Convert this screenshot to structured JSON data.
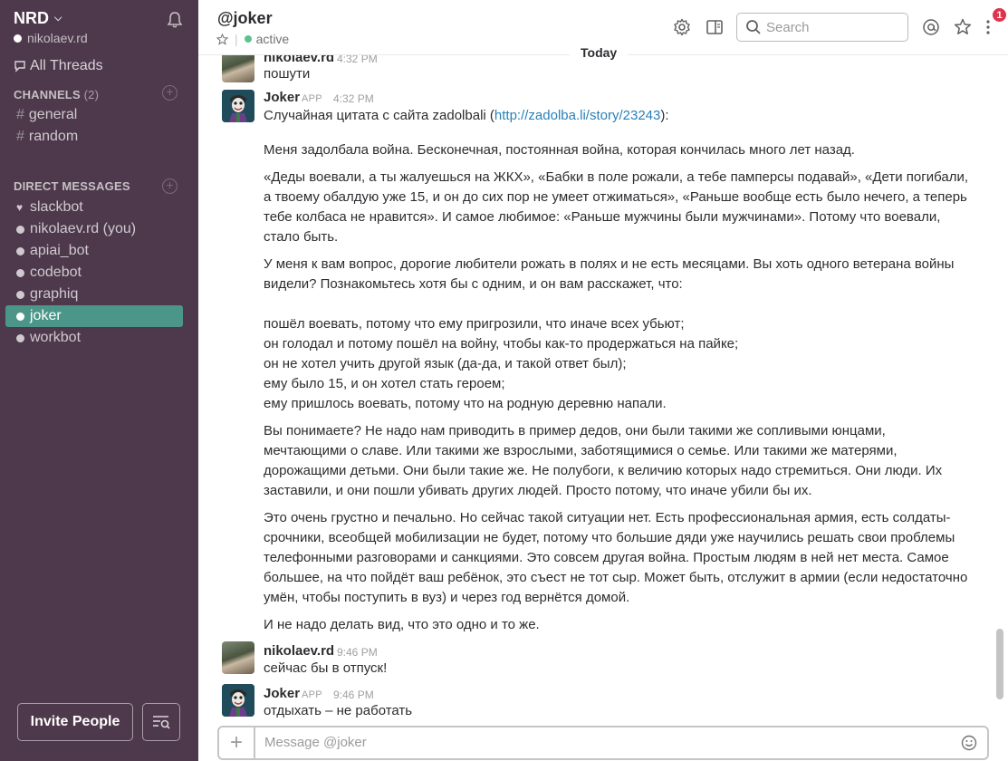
{
  "sidebar": {
    "team_name": "NRD",
    "user": "nikolaev.rd",
    "all_threads": "All Threads",
    "channels_header": "CHANNELS",
    "channels_count": "(2)",
    "channels": [
      {
        "label": "general"
      },
      {
        "label": "random"
      }
    ],
    "dm_header": "DIRECT MESSAGES",
    "dms": [
      {
        "label": "slackbot"
      },
      {
        "label": "nikolaev.rd (you)"
      },
      {
        "label": "apiai_bot"
      },
      {
        "label": "codebot"
      },
      {
        "label": "graphiq"
      },
      {
        "label": "joker"
      },
      {
        "label": "workbot"
      }
    ],
    "invite": "Invite People"
  },
  "header": {
    "title": "@joker",
    "status": "active",
    "search_placeholder": "Search",
    "notification_count": "1"
  },
  "divider": "Today",
  "messages": [
    {
      "sender": "nikolaev.rd",
      "time": "4:32 PM",
      "text": "пошути"
    },
    {
      "sender": "Joker",
      "app": "APP",
      "time": "4:32 PM",
      "intro": "Случайная цитата с сайта zadolbali (",
      "link": "http://zadolba.li/story/23243",
      "intro_end": "):",
      "paragraphs": [
        "Меня задолбала война. Бесконечная, постоянная война, которая кончилась много лет назад.",
        "«Деды воевали, а ты жалуешься на ЖКХ», «Бабки в поле рожали, а тебе памперсы подавай», «Дети погибали, а твоему обалдую уже 15, и он до сих пор не умеет отжиматься», «Раньше вообще есть было нечего, а теперь тебе колбаса не нравится». И самое любимое: «Раньше мужчины были мужчинами». Потому что воевали, стало быть.",
        "У меня к вам вопрос, дорогие любители рожать в полях и не есть месяцами. Вы хоть одного ветерана войны видели? Познакомьтесь хотя бы с одним, и он вам расскажет, что:"
      ],
      "list": [
        "пошёл воевать, потому что ему пригрозили, что иначе всех убьют;",
        "он голодал и потому пошёл на войну, чтобы как-то продержаться на пайке;",
        "он не хотел учить другой язык (да-да, и такой ответ был);",
        "ему было 15, и он хотел стать героем;",
        "ему пришлось воевать, потому что на родную деревню напали."
      ],
      "paragraphs2": [
        "Вы понимаете? Не надо нам приводить в пример дедов, они были такими же сопливыми юнцами, мечтающими о славе. Или такими же взрослыми, заботящимися о семье. Или такими же матерями, дорожащими детьми. Они были такие же. Не полубоги, к величию которых надо стремиться. Они люди. Их заставили, и они пошли убивать других людей. Просто потому, что иначе убили бы их.",
        "Это очень грустно и печально. Но сейчас такой ситуации нет. Есть профессиональная армия, есть солдаты-срочники, всеобщей мобилизации не будет, потому что большие дяди уже научились решать свои проблемы телефонными разговорами и санкциями. Это совсем другая война. Простым людям в ней нет места. Самое большее, на что пойдёт ваш ребёнок, это съест не тот сыр. Может быть, отслужит в армии (если недостаточно умён, чтобы поступить в вуз) и через год вернётся домой.",
        "И не надо делать вид, что это одно и то же."
      ]
    },
    {
      "sender": "nikolaev.rd",
      "time": "9:46 PM",
      "text": "сейчас бы в отпуск!"
    },
    {
      "sender": "Joker",
      "app": "APP",
      "time": "9:46 PM",
      "text": "отдыхать – не работать"
    }
  ],
  "composer": {
    "placeholder": "Message @joker"
  }
}
